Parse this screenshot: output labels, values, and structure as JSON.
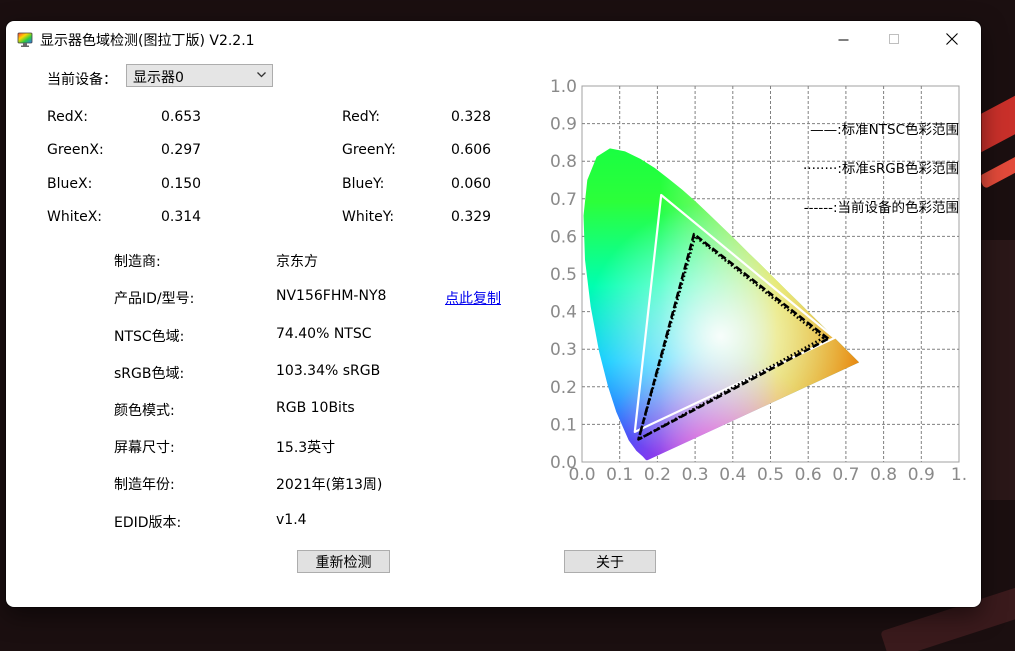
{
  "window": {
    "title": "显示器色域检测(图拉丁版) V2.2.1"
  },
  "device": {
    "label": "当前设备：",
    "selected": "显示器0"
  },
  "coords": [
    {
      "label": "RedX:",
      "value": "0.653",
      "label2": "RedY:",
      "value2": "0.328"
    },
    {
      "label": "GreenX:",
      "value": "0.297",
      "label2": "GreenY:",
      "value2": "0.606"
    },
    {
      "label": "BlueX:",
      "value": "0.150",
      "label2": "BlueY:",
      "value2": "0.060"
    },
    {
      "label": "WhiteX:",
      "value": "0.314",
      "label2": "WhiteY:",
      "value2": "0.329"
    }
  ],
  "info": [
    {
      "label": "制造商:",
      "value": "京东方"
    },
    {
      "label": "产品ID/型号:",
      "value": "NV156FHM-NY8"
    },
    {
      "label": "NTSC色域:",
      "value": "74.40% NTSC"
    },
    {
      "label": "sRGB色域:",
      "value": "103.34% sRGB"
    },
    {
      "label": "颜色模式:",
      "value": "RGB 10Bits"
    },
    {
      "label": "屏幕尺寸:",
      "value": "15.3英寸"
    },
    {
      "label": "制造年份:",
      "value": "2021年(第13周)"
    },
    {
      "label": "EDID版本:",
      "value": "v1.4"
    }
  ],
  "copy_link": "点此复制",
  "buttons": {
    "retest": "重新检测",
    "about": "关于"
  },
  "chart_data": {
    "type": "scatter",
    "xlim": [
      0,
      1
    ],
    "ylim": [
      0,
      1
    ],
    "x_ticks": [
      "0.0",
      "0.1",
      "0.2",
      "0.3",
      "0.4",
      "0.5",
      "0.6",
      "0.7",
      "0.8",
      "0.9",
      "1."
    ],
    "y_ticks": [
      "0.0",
      "0.1",
      "0.2",
      "0.3",
      "0.4",
      "0.5",
      "0.6",
      "0.7",
      "0.8",
      "0.9",
      "1.0"
    ],
    "grid": true,
    "legend_position": "top-right",
    "series": [
      {
        "name": "——:标准NTSC色彩范围",
        "style": "solid",
        "color": "#ffffff",
        "points": [
          [
            0.67,
            0.33
          ],
          [
            0.21,
            0.71
          ],
          [
            0.14,
            0.08
          ]
        ]
      },
      {
        "name": "········:标准sRGB色彩范围",
        "style": "dotted",
        "color": "#000000",
        "points": [
          [
            0.64,
            0.33
          ],
          [
            0.3,
            0.6
          ],
          [
            0.15,
            0.06
          ]
        ]
      },
      {
        "name": "------:当前设备的色彩范围",
        "style": "dashed",
        "color": "#000000",
        "points": [
          [
            0.653,
            0.328
          ],
          [
            0.297,
            0.606
          ],
          [
            0.15,
            0.06
          ]
        ]
      }
    ],
    "locus": [
      [
        0.174,
        0.005
      ],
      [
        0.17,
        0.005
      ],
      [
        0.161,
        0.015
      ],
      [
        0.144,
        0.03
      ],
      [
        0.124,
        0.058
      ],
      [
        0.091,
        0.133
      ],
      [
        0.069,
        0.201
      ],
      [
        0.045,
        0.295
      ],
      [
        0.023,
        0.413
      ],
      [
        0.008,
        0.538
      ],
      [
        0.004,
        0.655
      ],
      [
        0.014,
        0.75
      ],
      [
        0.039,
        0.812
      ],
      [
        0.074,
        0.834
      ],
      [
        0.114,
        0.826
      ],
      [
        0.155,
        0.806
      ],
      [
        0.193,
        0.782
      ],
      [
        0.229,
        0.754
      ],
      [
        0.266,
        0.724
      ],
      [
        0.302,
        0.692
      ],
      [
        0.337,
        0.659
      ],
      [
        0.373,
        0.624
      ],
      [
        0.409,
        0.589
      ],
      [
        0.444,
        0.554
      ],
      [
        0.479,
        0.52
      ],
      [
        0.512,
        0.487
      ],
      [
        0.548,
        0.451
      ],
      [
        0.584,
        0.416
      ],
      [
        0.627,
        0.373
      ],
      [
        0.67,
        0.33
      ],
      [
        0.735,
        0.265
      ]
    ]
  },
  "colors": {
    "window_bg": "#ffffff",
    "accent_red": "#e53a2c",
    "link": "#0000ee",
    "ntsc_line": "#ffffff",
    "device_line": "#000000"
  },
  "icons": {
    "app": "color-monitor-icon",
    "minimize": "minimize-icon",
    "maximize": "maximize-icon",
    "close": "close-icon",
    "dropdown": "chevron-down-icon"
  }
}
